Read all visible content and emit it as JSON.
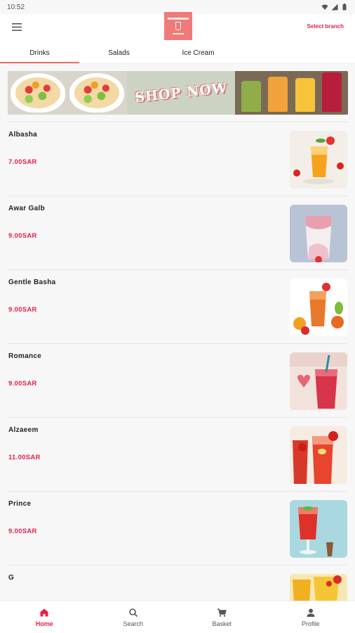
{
  "status": {
    "time": "10:52"
  },
  "header": {
    "select_branch": "Select branch"
  },
  "tabs": [
    {
      "label": "Drinks",
      "active": true
    },
    {
      "label": "Salads",
      "active": false
    },
    {
      "label": "Ice Cream",
      "active": false
    }
  ],
  "banner": {
    "text": "SHOP NOW"
  },
  "products": [
    {
      "name": "Albasha",
      "price": "7.00SAR",
      "image": "orange-juice"
    },
    {
      "name": "Awar Galb",
      "price": "9.00SAR",
      "image": "strawberry-milk"
    },
    {
      "name": "Gentle Basha",
      "price": "9.00SAR",
      "image": "mixed-fruit-juice"
    },
    {
      "name": "Romance",
      "price": "9.00SAR",
      "image": "red-smoothie"
    },
    {
      "name": "Alzaeem",
      "price": "11.00SAR",
      "image": "strawberry-lemonade"
    },
    {
      "name": "Prince",
      "price": "9.00SAR",
      "image": "red-cocktail"
    },
    {
      "name": "G",
      "price": "",
      "image": "mango-drink"
    }
  ],
  "bottom_nav": [
    {
      "label": "Home",
      "icon": "home-icon",
      "active": true
    },
    {
      "label": "Search",
      "icon": "search-icon",
      "active": false
    },
    {
      "label": "Basket",
      "icon": "cart-icon",
      "active": false
    },
    {
      "label": "Profile",
      "icon": "person-icon",
      "active": false
    }
  ],
  "colors": {
    "accent": "#e8204a",
    "tab_indicator": "#f06a6a",
    "logo_bg": "#f07a7a"
  }
}
